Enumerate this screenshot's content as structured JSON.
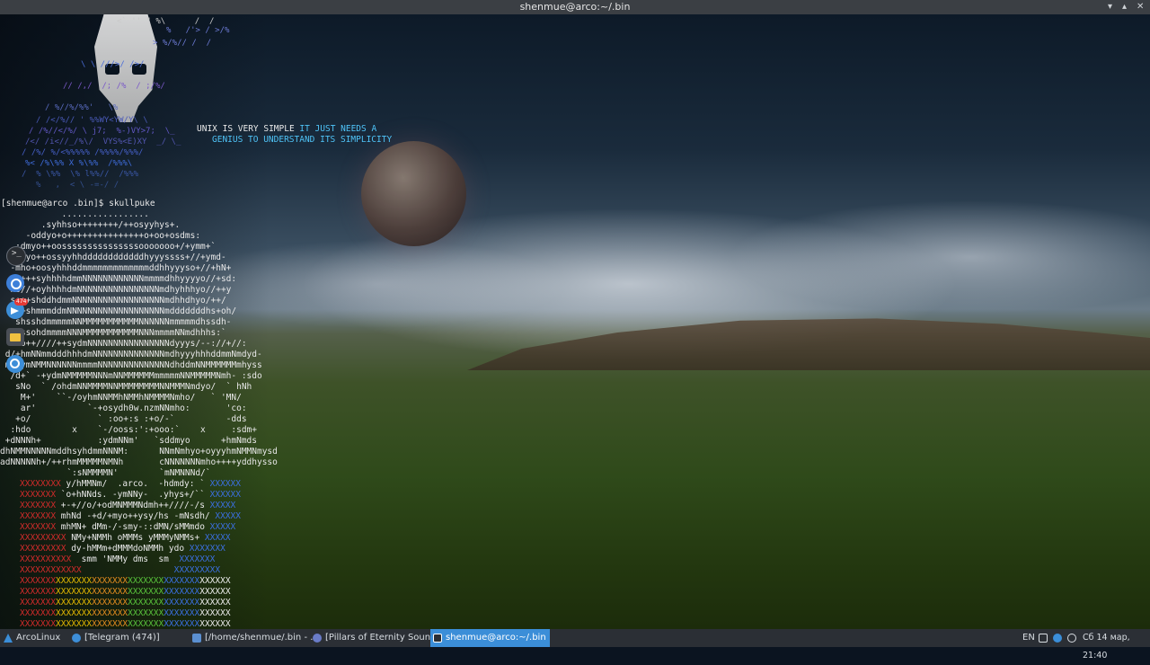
{
  "window": {
    "title": "shenmue@arco:~/.bin",
    "controls": {
      "minimize": "▾",
      "maximize": "▴",
      "close": "✕"
    }
  },
  "terminal": {
    "quote_plain": "UNIX IS VERY SIMPLE ",
    "quote_colored_1": "IT JUST NEEDS A",
    "quote_colored_2": "GENIUS TO UNDERSTAND ITS SIMPLICITY",
    "prompt_text": "[shenmue@arco .bin]$ skullpuke",
    "skull_lines": [
      "            .................",
      "        .syhhso++++++++/++osyyhys+.",
      "     -oddyo+o+++++++++++++++o+oo+osdms:",
      "   :dmyo++oosssssssssssssssooooooo+/+ymm+`",
      "   hmyo++ossyyhhddddddddddddhyyyssss+//+ymd-",
      "  -mho+oosyhhhddmmmmmmmmmmmmmddhhyyyso+//+hN+",
      "  my+++syhhhhdmmNNNNNNNNNNNNmmmmdhhyyyyo//+sd:",
      "  hs//+oyhhhhdmNNNNNNNNNNNNNNNNmdhyhhhyo//++y",
      "  s+++shddhdmmNNNNNNNNNNNNNNNNNNmdhhdhyo/++/",
      "  hs+shmmmddmNNNNNNNNNNNNNNNNNNNmdddddddhs+oh/",
      "   shsshdmmmmmNNMMMMMMMMMMMNNNNNNmmmmmdhssdh-",
      "   +ssohdmmmmNNNMMMMMMMMMMMNNNmmmmNNmdhhhs:`",
      "   oo++////++sydmNNNNNNNNNNNNNNNNdyyys/--://+//:",
      " d/+hmNNmmdddhhhdmNNNNNNNNNNNNNNmdhyyyhhhddmmNmdyd-",
      " m-+ymNMMNNNNNNmmmmNNNNNNNNNNNNNNdhddmNNMMMMMMmhyss",
      "  /d+` -+ydmNMMMMMNNNmNNMMMMMMmmmmmNNMMMMMNmh- :sdo",
      "   sNo  ` /ohdmNNMMMMNNMMMMMMMMNNMMMNmdyo/  ` hNh",
      "    M+'    ``-/oyhmNNMMhNMMhNMMMMNmho/   ` 'MN/",
      "    ar'          `-+osydh0w.nzmNNmho:       'co:",
      "   +o/             ` :oo+:s :+o/-`          -dds",
      "  :hdo        x    `-/ooss:':+ooo:`    x     :sdm+",
      " +dNNNh+           :ydmNNm'   `sddmyo      +hmNmds",
      "dhNMMNNNNNmddhsyhdmmNNNM:      NNmNmhyo+oyyyhmNMMNmysd",
      "adNNNNNh+/++rhmMMMMMNMNh       cNNNNNNNmho++++yddhysso",
      "             `:sNMMMMN'        `mNMNNNd/`"
    ],
    "logo_lines": [
      {
        "pre": "XXXXXXXX",
        "mid": " y/hMMNm/  .arco.  -hdmdy: ` ",
        "post": "XXXXXX"
      },
      {
        "pre": "XXXXXXX",
        "mid": " `o+hNNds. -ymNNy-  .yhys+/`` ",
        "post": "XXXXXX"
      },
      {
        "pre": "XXXXXXX",
        "mid": " +-+//o/+odMNMMMNdmh++////-/s ",
        "post": "XXXXX"
      },
      {
        "pre": "XXXXXXX",
        "mid": " mhNd -+d/+myo++ysy/hs -mNsdh/ ",
        "post": "XXXXX"
      },
      {
        "pre": "XXXXXXX",
        "mid": " mhMN+ dMm-/-smy-::dMN/sMMmdo ",
        "post": "XXXXX"
      },
      {
        "pre": "XXXXXXXXX",
        "mid": " NMy+NMMh oMMMs yMMMyNMMs+ ",
        "post": "XXXXX"
      },
      {
        "pre": "XXXXXXXXX",
        "mid": " dy-hMMm+dMMMdoNMMh ydo ",
        "post": "XXXXXXX"
      },
      {
        "pre": "XXXXXXXXXX",
        "mid": "  smm 'NMMy dms  sm  ",
        "post": "XXXXXXX"
      },
      {
        "pre": "XXXXXXXXXXXX",
        "mid": "                  ",
        "post": "XXXXXXXXX"
      }
    ],
    "color_bars": [
      "XXXXXXXXXXXXXXXXXXXXXXXXXXXXXXXXXXXXXXXXX",
      "XXXXXXXXXXXXXXXXXXXXXXXXXXXXXXXXXXXXXXXXX",
      "XXXXXXXXXXXXXXXXXXXXXXXXXXXXXXXXXXXXXXXXX",
      "XXXXXXXXXXXXXXXXXXXXXXXXXXXXXXXXXXXXXXXXX",
      "XXXXXXXXXXXXXXXXXXXXXXXXXXXXXXXXXXXXXXXXX"
    ]
  },
  "taskbar": {
    "start_label": "ArcoLinux",
    "tasks": [
      {
        "label": "[Telegram (474)]",
        "icon": "telegram-icon"
      },
      {
        "label": "[/home/shenmue/.bin - ...",
        "icon": "folder-icon"
      },
      {
        "label": "[Pillars of Eternity Soun...",
        "icon": "media-icon"
      },
      {
        "label": "shenmue@arco:~/.bin",
        "icon": "terminal-icon"
      }
    ],
    "tray": {
      "language": "EN",
      "clock": "Сб 14 мар, 21:40"
    }
  },
  "dock": {
    "telegram_badge": "474"
  },
  "colors": {
    "accent": "#3b8ed8",
    "titlebar": "#3b3f44",
    "taskbar": "#2b2f35",
    "quote_cyan": "#4fc3f7"
  }
}
